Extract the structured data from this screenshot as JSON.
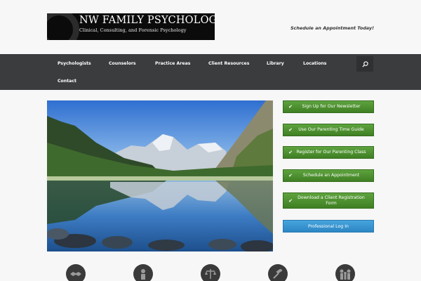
{
  "header": {
    "logo_title": "NW FAMILY PSYCHOLOGY",
    "logo_subtitle": "Clinical, Consulting, and Forensic Psychology",
    "schedule_link": "Schedule an Appointment Today!"
  },
  "nav": {
    "items": [
      {
        "label": "Psychologists"
      },
      {
        "label": "Counselors"
      },
      {
        "label": "Practice Areas"
      },
      {
        "label": "Client Resources"
      },
      {
        "label": "Library"
      },
      {
        "label": "Locations"
      },
      {
        "label": "Contact"
      }
    ],
    "search_icon": "search-icon"
  },
  "sidebar": {
    "buttons": [
      {
        "label": "Sign Up for Our Newsletter",
        "icon": "check-icon"
      },
      {
        "label": "Use Our Parenting Time Guide",
        "icon": "check-icon"
      },
      {
        "label": "Register for Our Parenting Class",
        "icon": "check-icon"
      },
      {
        "label": "Schedule an Appointment",
        "icon": "check-icon"
      },
      {
        "label": "Download a Client Registration Form",
        "icon": "check-icon"
      }
    ],
    "login_label": "Professional Log In"
  },
  "feature_icons": [
    "handshake-icon",
    "child-icon",
    "scales-icon",
    "gavel-icon",
    "family-icon"
  ],
  "colors": {
    "nav_bg": "#3a3c3e",
    "green_button": "#4e9131",
    "blue_button": "#3596d2",
    "logo_bg": "#0b0b0b"
  }
}
